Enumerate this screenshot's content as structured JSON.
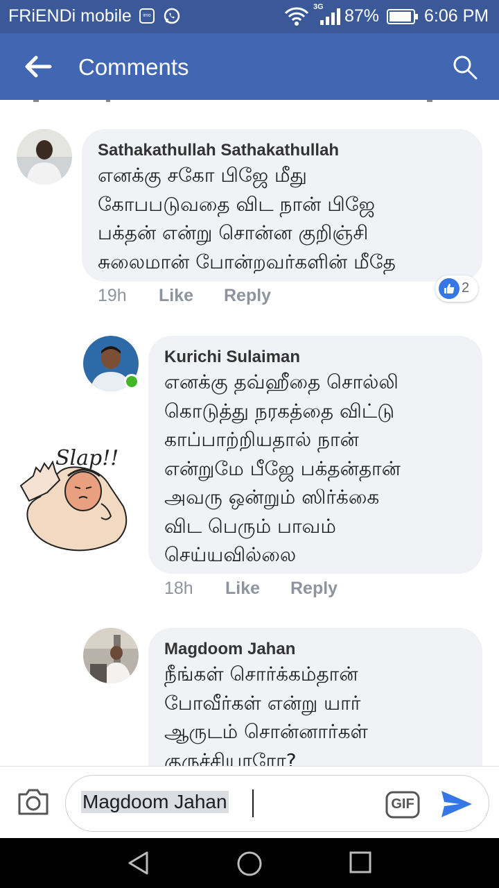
{
  "status_bar": {
    "carrier": "FRiENDi mobile",
    "imo_label": "imo",
    "network": "3G",
    "battery": "87%",
    "time": "6:06 PM"
  },
  "app_bar": {
    "title": "Comments",
    "back_icon": "arrow-left-icon",
    "search_icon": "search-icon"
  },
  "comments": [
    {
      "author": "Sathakathullah Sathakathullah",
      "text": "எனக்கு சகோ பிஜே மீது\nகோபபடுவதை விட நான் பிஜே\nபக்தன் என்று சொன்ன குறிஞ்சி\nசுலைமான் போன்றவர்களின் மீதே",
      "time": "19h",
      "like_label": "Like",
      "reply_label": "Reply",
      "reaction_count": "2"
    },
    {
      "author": "Kurichi Sulaiman",
      "text": "எனக்கு தவ்ஹீதை சொல்லி\nகொடுத்து நரகத்தை விட்டு\nகாப்பாற்றியதால் நான்\nஎன்றுமே பீஜே பக்தன்தான்\nஅவரு ஒன்றும் ஸிர்க்கை\nவிட பெரும் பாவம்\nசெய்யவில்லை",
      "time": "18h",
      "like_label": "Like",
      "reply_label": "Reply",
      "sticker_text": "Slap!!"
    },
    {
      "author": "Magdoom Jahan",
      "text": "நீங்கள் சொர்க்கம்தான்\nபோவீர்கள் என்று யார்\nஆருடம் சொன்னார்கள்\nகுருச்சியாரோ?"
    }
  ],
  "composer": {
    "input_value": "Magdoom Jahan",
    "gif_label": "GIF",
    "camera_icon": "camera-icon",
    "send_icon": "send-icon"
  },
  "colors": {
    "status_bar": "#3b5998",
    "app_bar": "#4267b2",
    "bubble": "#f0f2f5",
    "accent": "#3578e5",
    "online": "#42b72a"
  }
}
